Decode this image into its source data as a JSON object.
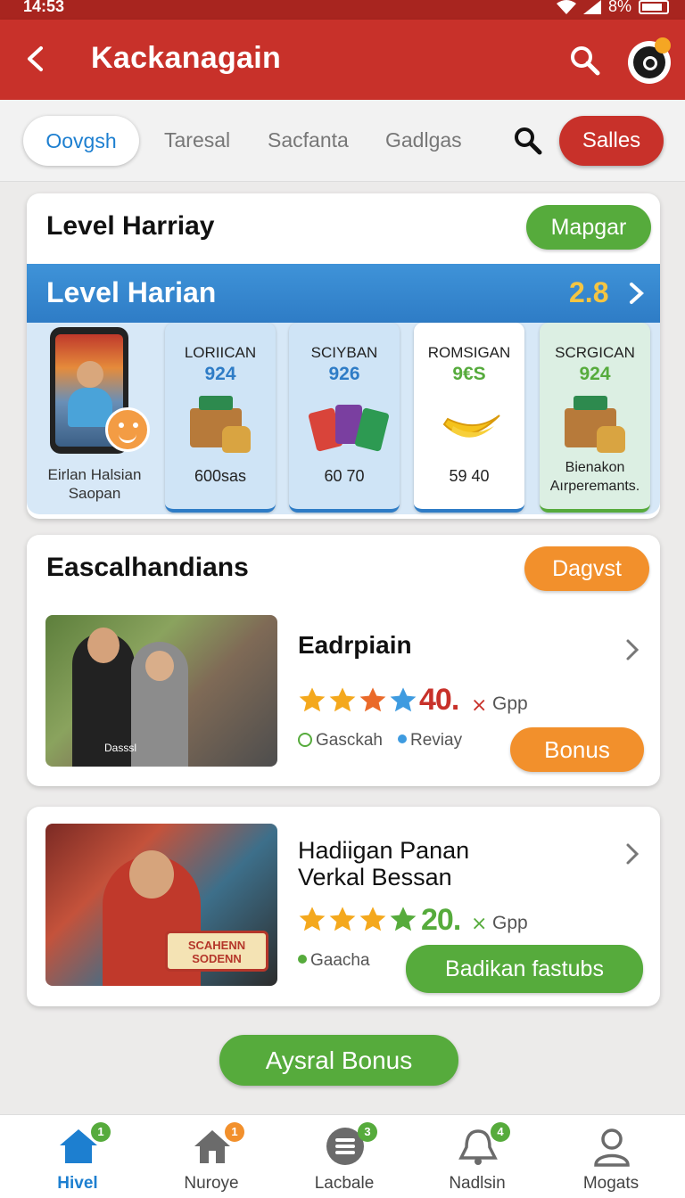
{
  "status": {
    "time": "14:53",
    "battery": "8%"
  },
  "appbar": {
    "title": "Kackanagain"
  },
  "tabs": [
    "Oovgsh",
    "Taresal",
    "Sacfanta",
    "Gadlgas"
  ],
  "sales_label": "Salles",
  "level_card": {
    "heading": "Level Harriay",
    "action": "Mapgar",
    "banner_title": "Level Harian",
    "banner_value": "2.8",
    "player_name": "Eirlan Halsian Saopan",
    "rewards": [
      {
        "name": "LORIICAN",
        "code": "924",
        "qty": "600sas"
      },
      {
        "name": "SCIYBAN",
        "code": "926",
        "qty": "60 70"
      },
      {
        "name": "ROMSIGAN",
        "code": "9€S",
        "qty": "59 40"
      },
      {
        "name": "SCRGICAN",
        "code": "924",
        "qty": "Bienakon Aırperemants."
      }
    ]
  },
  "events_card": {
    "heading": "Eascalhandians",
    "action": "Dagvst",
    "item": {
      "title": "Eadrpiain",
      "rating": "40.",
      "x_mark": "⨯",
      "unit": "Gpp",
      "tags": [
        "Gasckah",
        "Reviay"
      ],
      "button": "Bonus",
      "photo_caption": "Dasssl"
    }
  },
  "second_item": {
    "title_line1": "Hadiigan Panan",
    "title_line2": "Verkal Bessan",
    "rating": "20.",
    "x_mark": "⨯",
    "unit": "Gpp",
    "tag": "Gaacha",
    "button": "Badikan fastubs",
    "sign_line1": "SCAHENN",
    "sign_line2": "SODENN"
  },
  "bottom_button": "Aysral Bonus",
  "nav": [
    {
      "label": "Hivel",
      "badge": "1"
    },
    {
      "label": "Nuroye",
      "badge": "1"
    },
    {
      "label": "Lacbale",
      "badge": "3"
    },
    {
      "label": "Nadlsin",
      "badge": "4"
    },
    {
      "label": "Mogats",
      "badge": ""
    }
  ],
  "colors": {
    "primary_red": "#c8312a",
    "accent_blue": "#1d7fd0",
    "green": "#56ab3c",
    "orange": "#f2902c",
    "gold": "#f4c542"
  }
}
